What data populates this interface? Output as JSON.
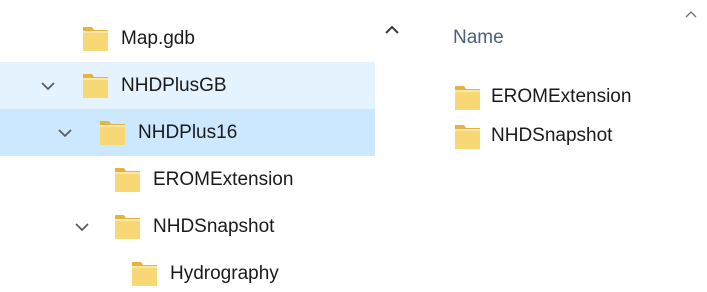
{
  "nav_tree": {
    "items": [
      {
        "label": "Map.gdb",
        "expanded": false,
        "has_toggle": false,
        "state": "normal"
      },
      {
        "label": "NHDPlusGB",
        "expanded": true,
        "has_toggle": true,
        "state": "hover"
      },
      {
        "label": "NHDPlus16",
        "expanded": true,
        "has_toggle": true,
        "state": "selected"
      },
      {
        "label": "EROMExtension",
        "expanded": false,
        "has_toggle": false,
        "state": "normal"
      },
      {
        "label": "NHDSnapshot",
        "expanded": true,
        "has_toggle": true,
        "state": "normal"
      },
      {
        "label": "Hydrography",
        "expanded": false,
        "has_toggle": false,
        "state": "normal"
      }
    ]
  },
  "content": {
    "column_header": "Name",
    "items": [
      {
        "label": "EROMExtension",
        "icon": "folder-icon"
      },
      {
        "label": "NHDSnapshot",
        "icon": "folder-icon"
      }
    ]
  },
  "icons": {
    "folder": "folder-icon",
    "expand": "chevron-down-icon",
    "scroll_up": "chevron-up-icon"
  },
  "colors": {
    "hover_row": "#e5f3ff",
    "selected_row": "#cce8ff",
    "folder_body": "#f8d775",
    "folder_back": "#e4b440",
    "header_text": "#4c607a"
  }
}
